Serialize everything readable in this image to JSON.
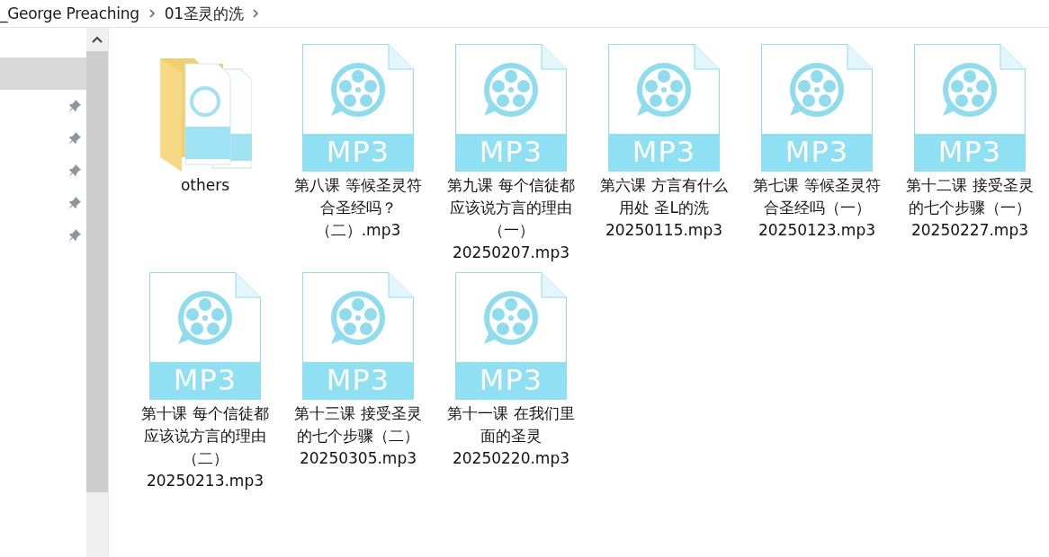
{
  "breadcrumb": [
    "_George Preaching",
    "01圣灵的洗"
  ],
  "nav_items": [
    {
      "selected": true,
      "pinned": false
    },
    {
      "selected": false,
      "pinned": true
    },
    {
      "selected": false,
      "pinned": true
    },
    {
      "selected": false,
      "pinned": true
    },
    {
      "selected": false,
      "pinned": true
    },
    {
      "selected": false,
      "pinned": true
    }
  ],
  "files": [
    {
      "kind": "folder",
      "name": "others"
    },
    {
      "kind": "mp3",
      "badge": "MP3",
      "name": "第八课 等候圣灵符合圣经吗？（二）.mp3"
    },
    {
      "kind": "mp3",
      "badge": "MP3",
      "name": "第九课 每个信徒都应该说方言的理由（一）20250207.mp3"
    },
    {
      "kind": "mp3",
      "badge": "MP3",
      "name": "第六课 方言有什么用处 圣L的洗20250115.mp3"
    },
    {
      "kind": "mp3",
      "badge": "MP3",
      "name": "第七课 等候圣灵符合圣经吗（一）20250123.mp3"
    },
    {
      "kind": "mp3",
      "badge": "MP3",
      "name": "第十二课 接受圣灵的七个步骤（一）20250227.mp3"
    },
    {
      "kind": "mp3",
      "badge": "MP3",
      "name": "第十课  每个信徒都应该说方言的理由（二）20250213.mp3"
    },
    {
      "kind": "mp3",
      "badge": "MP3",
      "name": "第十三课 接受圣灵的七个步骤（二）20250305.mp3"
    },
    {
      "kind": "mp3",
      "badge": "MP3",
      "name": "第十一课 在我们里面的圣灵20250220.mp3"
    }
  ]
}
